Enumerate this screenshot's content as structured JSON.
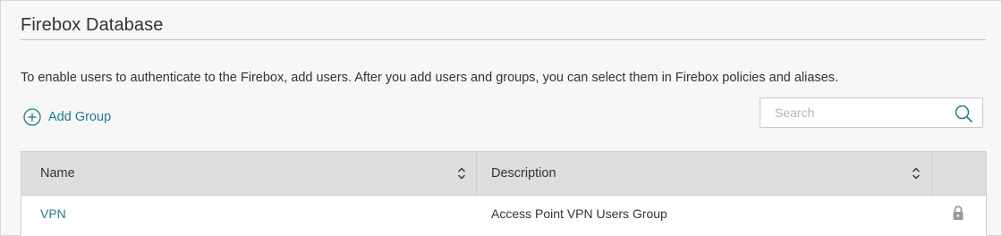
{
  "section": {
    "title": "Firebox Database",
    "intro": "To enable users to authenticate to the Firebox, add users. After you add users and groups, you can select them in Firebox policies and aliases."
  },
  "toolbar": {
    "add_group_label": "Add Group",
    "add_group_icon": "plus-circle-icon"
  },
  "search": {
    "placeholder": "Search",
    "value": "",
    "icon": "search-icon"
  },
  "table": {
    "columns": [
      {
        "label": "Name",
        "sortable": true
      },
      {
        "label": "Description",
        "sortable": true
      },
      {
        "label": "",
        "sortable": false
      }
    ],
    "rows": [
      {
        "name": "VPN",
        "description": "Access Point VPN Users Group",
        "locked": true,
        "action_icon": "lock-icon"
      }
    ]
  },
  "colors": {
    "accent": "#1e7c89",
    "header_bg": "#dedede",
    "page_bg": "#f7f7f7",
    "text": "#333333"
  }
}
